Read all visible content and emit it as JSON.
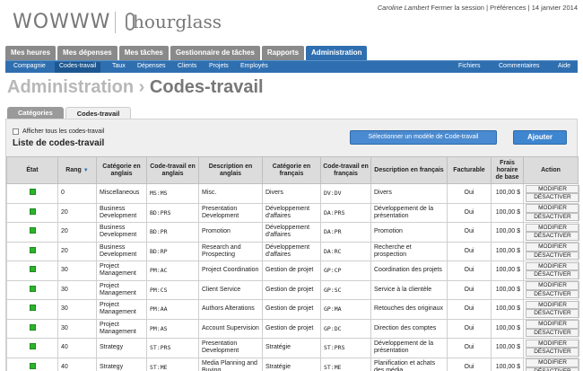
{
  "brand": {
    "wowww": "WOWWW",
    "hourglass": "hourglass"
  },
  "toplinks": {
    "user": "Caroline Lambert",
    "logout": "Fermer la session",
    "sep1": "|",
    "prefs": "Préférences",
    "sep2": "|",
    "date": "14 janvier 2014"
  },
  "main_tabs": [
    {
      "label": "Mes heures"
    },
    {
      "label": "Mes dépenses"
    },
    {
      "label": "Mes tâches"
    },
    {
      "label": "Gestionnaire de tâches"
    },
    {
      "label": "Rapports"
    },
    {
      "label": "Administration"
    }
  ],
  "subnav": {
    "left": [
      "Compagnie",
      "Codes-travail",
      "Taux",
      "Dépenses",
      "Clients",
      "Projets",
      "Employés"
    ],
    "right": [
      "Fichiers",
      "Commentaires",
      "Aide"
    ]
  },
  "page_title": {
    "crumb": "Administration ›",
    "current": "Codes-travail"
  },
  "sub_tabs": [
    "Catégories",
    "Codes-travail"
  ],
  "panel": {
    "show_all": "Afficher tous les codes-travail",
    "list_title": "Liste de codes-travail",
    "model_button": "Sélectionner un modèle de Code-travail",
    "add_button": "Ajouter"
  },
  "table": {
    "headers": [
      "État",
      "Rang",
      "Catégorie en anglais",
      "Code-travail en anglais",
      "Description en anglais",
      "Catégorie en français",
      "Code-travail en français",
      "Description en français",
      "Facturable",
      "Frais horaire de base",
      "Action"
    ],
    "sort_icon": "▼",
    "modify": "MODIFIER",
    "deactivate": "DÉSACTIVER",
    "rows": [
      {
        "rank": "0",
        "cat_en": "Miscellaneous",
        "code_en": "MS:MS",
        "desc_en": "Misc.",
        "cat_fr": "Divers",
        "code_fr": "DV:DV",
        "desc_fr": "Divers",
        "billable": "Oui",
        "rate": "100,00 $"
      },
      {
        "rank": "20",
        "cat_en": "Business Development",
        "code_en": "BD:PRS",
        "desc_en": "Presentation Development",
        "cat_fr": "Développement d'affaires",
        "code_fr": "DA:PRS",
        "desc_fr": "Développement de la présentation",
        "billable": "Oui",
        "rate": "100,00 $"
      },
      {
        "rank": "20",
        "cat_en": "Business Development",
        "code_en": "BD:PR",
        "desc_en": "Promotion",
        "cat_fr": "Développement d'affaires",
        "code_fr": "DA:PR",
        "desc_fr": "Promotion",
        "billable": "Oui",
        "rate": "100,00 $"
      },
      {
        "rank": "20",
        "cat_en": "Business Development",
        "code_en": "BD:RP",
        "desc_en": "Research and Prospecting",
        "cat_fr": "Développement d'affaires",
        "code_fr": "DA:RC",
        "desc_fr": "Recherche et prospection",
        "billable": "Oui",
        "rate": "100,00 $"
      },
      {
        "rank": "30",
        "cat_en": "Project Management",
        "code_en": "PM:AC",
        "desc_en": "Project Coordination",
        "cat_fr": "Gestion de projet",
        "code_fr": "GP:CP",
        "desc_fr": "Coordination des projets",
        "billable": "Oui",
        "rate": "100,00 $"
      },
      {
        "rank": "30",
        "cat_en": "Project Management",
        "code_en": "PM:CS",
        "desc_en": "Client Service",
        "cat_fr": "Gestion de projet",
        "code_fr": "GP:SC",
        "desc_fr": "Service à la clientèle",
        "billable": "Oui",
        "rate": "100,00 $"
      },
      {
        "rank": "30",
        "cat_en": "Project Management",
        "code_en": "PM:AA",
        "desc_en": "Authors Alterations",
        "cat_fr": "Gestion de projet",
        "code_fr": "GP:MA",
        "desc_fr": "Retouches des originaux",
        "billable": "Oui",
        "rate": "100,00 $"
      },
      {
        "rank": "30",
        "cat_en": "Project Management",
        "code_en": "PM:AS",
        "desc_en": "Account Supervision",
        "cat_fr": "Gestion de projet",
        "code_fr": "GP:DC",
        "desc_fr": "Direction des comptes",
        "billable": "Oui",
        "rate": "100,00 $"
      },
      {
        "rank": "40",
        "cat_en": "Strategy",
        "code_en": "ST:PRS",
        "desc_en": "Presentation Development",
        "cat_fr": "Stratégie",
        "code_fr": "ST:PRS",
        "desc_fr": "Développement de la présentation",
        "billable": "Oui",
        "rate": "100,00 $"
      },
      {
        "rank": "40",
        "cat_en": "Strategy",
        "code_en": "ST:ME",
        "desc_en": "Media Planning and Buying",
        "cat_fr": "Stratégie",
        "code_fr": "ST:ME",
        "desc_fr": "Planification et achats des média",
        "billable": "Oui",
        "rate": "100,00 $"
      }
    ]
  },
  "colors": {
    "accent": "#2f6fb0",
    "status_active": "#2db32d"
  }
}
